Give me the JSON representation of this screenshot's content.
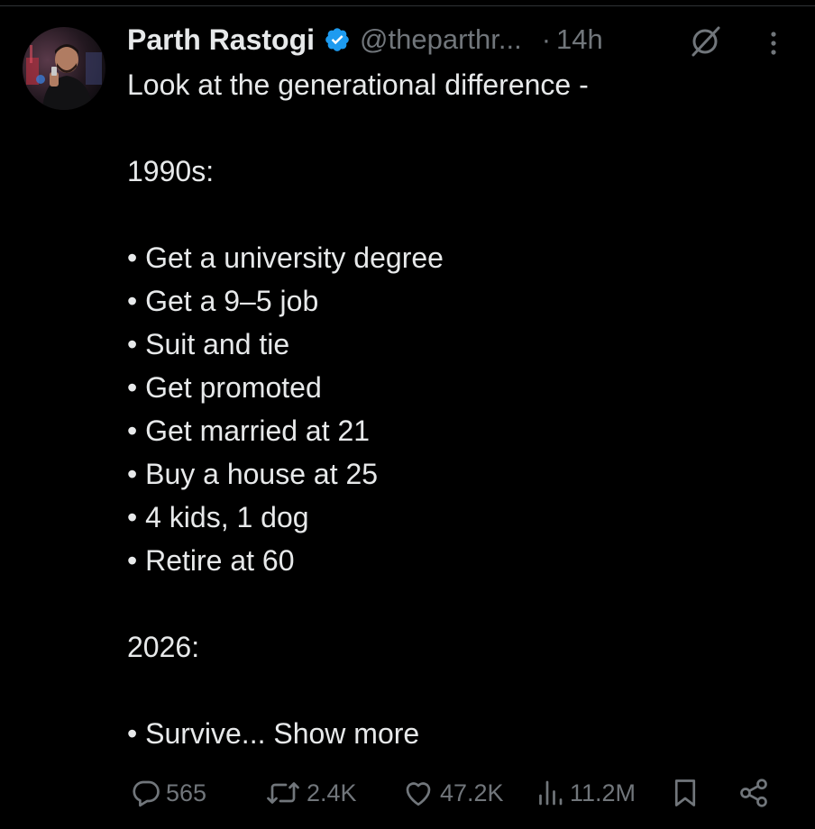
{
  "post": {
    "author": {
      "name": "Parth Rastogi",
      "handle": "@theparthr...",
      "verified_icon": "verified-badge-icon",
      "avatar": "avatar-photo"
    },
    "separator": "·",
    "time": "14h",
    "text": {
      "intro": "Look at the generational difference  -",
      "heading_1990s": "1990s:",
      "list_1990s": [
        "• Get a university degree",
        "• Get a 9–5 job",
        "• Suit and tie",
        "• Get promoted",
        "• Get married at 21",
        "• Buy a house at 25",
        "• 4 kids, 1 dog",
        "• Retire at 60"
      ],
      "heading_2026": "2026:",
      "last_line": "• Survive...",
      "show_more": "Show more"
    },
    "actions": {
      "replies": "565",
      "reposts": "2.4K",
      "likes": "47.2K",
      "views": "11.2M"
    }
  },
  "colors": {
    "background": "#000000",
    "text": "#e7e9ea",
    "muted": "#71767b",
    "verified": "#1d9bf0"
  },
  "icons": [
    "verified-badge-icon",
    "grok-icon",
    "more-icon",
    "reply-icon",
    "repost-icon",
    "like-icon",
    "views-icon",
    "bookmark-icon",
    "share-icon"
  ]
}
